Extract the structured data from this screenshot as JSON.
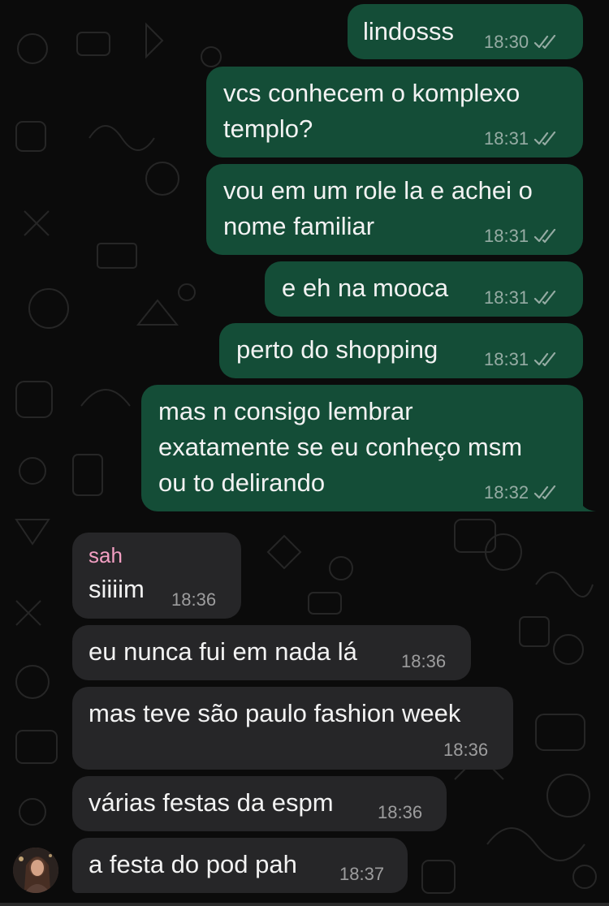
{
  "theme": {
    "outgoing_bubble": "#144d37",
    "incoming_bubble": "#262628",
    "sender_color": "#f39fc3",
    "background": "#0b0b0b"
  },
  "messages": [
    {
      "direction": "outgoing",
      "lines": [
        "lindosss"
      ],
      "time": "18:30",
      "status": "read-ticks-icon"
    },
    {
      "direction": "outgoing",
      "lines": [
        "vcs conhecem o komplexo",
        "templo?"
      ],
      "time": "18:31",
      "status": "read-ticks-icon"
    },
    {
      "direction": "outgoing",
      "lines": [
        "vou em um role la e achei o",
        "nome familiar"
      ],
      "time": "18:31",
      "status": "read-ticks-icon"
    },
    {
      "direction": "outgoing",
      "lines": [
        "e eh na mooca"
      ],
      "time": "18:31",
      "status": "read-ticks-icon"
    },
    {
      "direction": "outgoing",
      "lines": [
        "perto do shopping"
      ],
      "time": "18:31",
      "status": "read-ticks-icon"
    },
    {
      "direction": "outgoing",
      "lines": [
        "mas n consigo lembrar",
        "exatamente se eu conheço msm",
        "ou to delirando"
      ],
      "time": "18:32",
      "status": "read-ticks-icon"
    },
    {
      "direction": "incoming",
      "sender": "sah",
      "lines": [
        "siiiim"
      ],
      "time": "18:36"
    },
    {
      "direction": "incoming",
      "lines": [
        "eu nunca fui em nada lá"
      ],
      "time": "18:36"
    },
    {
      "direction": "incoming",
      "lines": [
        "mas teve são paulo fashion week"
      ],
      "time": "18:36"
    },
    {
      "direction": "incoming",
      "lines": [
        "várias festas da espm"
      ],
      "time": "18:36"
    },
    {
      "direction": "incoming",
      "lines": [
        "a festa do pod pah"
      ],
      "time": "18:37"
    }
  ]
}
